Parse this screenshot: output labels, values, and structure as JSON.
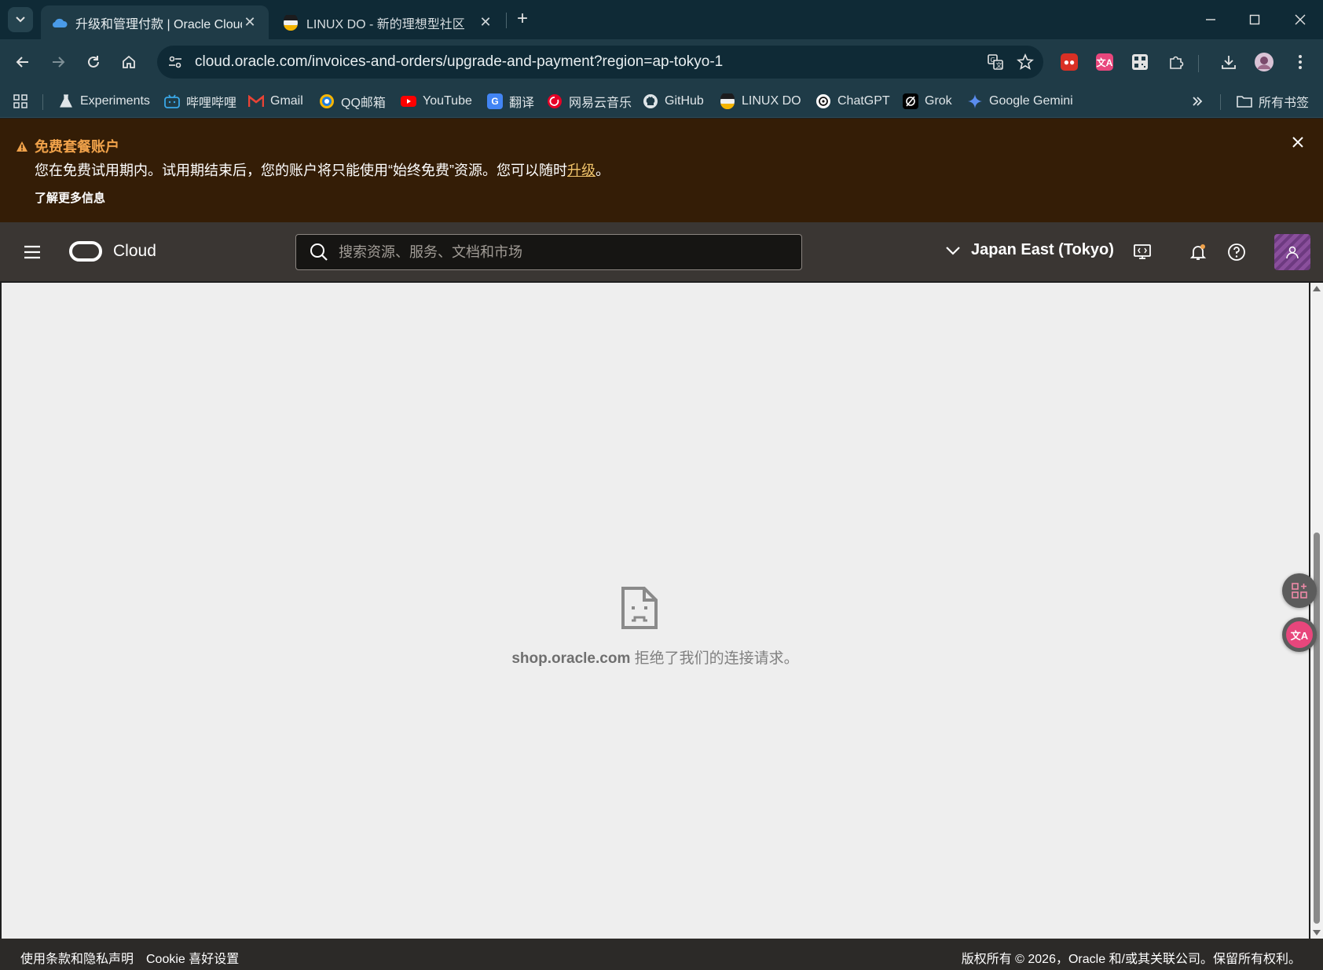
{
  "browser": {
    "tabs": [
      {
        "title": "升级和管理付款 | Oracle Cloud",
        "active": true
      },
      {
        "title": "LINUX DO - 新的理想型社区",
        "active": false
      }
    ],
    "url": "cloud.oracle.com/invoices-and-orders/upgrade-and-payment?region=ap-tokyo-1",
    "bookmarks": [
      {
        "label": "Experiments",
        "icon": "flask-icon"
      },
      {
        "label": "哔哩哔哩",
        "icon": "bilibili-icon"
      },
      {
        "label": "Gmail",
        "icon": "gmail-icon"
      },
      {
        "label": "QQ邮箱",
        "icon": "qqmail-icon"
      },
      {
        "label": "YouTube",
        "icon": "youtube-icon"
      },
      {
        "label": "翻译",
        "icon": "translate-icon"
      },
      {
        "label": "网易云音乐",
        "icon": "netease-music-icon"
      },
      {
        "label": "GitHub",
        "icon": "github-icon"
      },
      {
        "label": "LINUX DO",
        "icon": "linuxdo-icon"
      },
      {
        "label": "ChatGPT",
        "icon": "chatgpt-icon"
      },
      {
        "label": "Grok",
        "icon": "grok-icon"
      },
      {
        "label": "Google Gemini",
        "icon": "gemini-icon"
      }
    ],
    "all_bookmarks_label": "所有书签"
  },
  "banner": {
    "title": "免费套餐账户",
    "body_prefix": "您在免费试用期内。试用期结束后，您的账户将只能使用“始终免费”资源。您可以随时",
    "upgrade_link": "升级",
    "body_suffix": "。",
    "learn_more": "了解更多信息"
  },
  "header": {
    "brand": "Cloud",
    "search_placeholder": "搜索资源、服务、文档和市场",
    "region": "Japan East (Tokyo)"
  },
  "content": {
    "error_host": "shop.oracle.com",
    "error_message": " 拒绝了我们的连接请求。"
  },
  "footer": {
    "terms": "使用条款和隐私声明",
    "cookie": "Cookie 喜好设置",
    "copyright": "版权所有 © 2026，Oracle 和/或其关联公司。保留所有权利。"
  },
  "colors": {
    "tabstrip": "#0f2a36",
    "toolbar": "#1f3b47",
    "banner_bg": "#341d06",
    "banner_title": "#f0a24a",
    "oracle_header": "#3a3633",
    "content_bg": "#eeeeee",
    "footer_bg": "#2c2a28"
  }
}
